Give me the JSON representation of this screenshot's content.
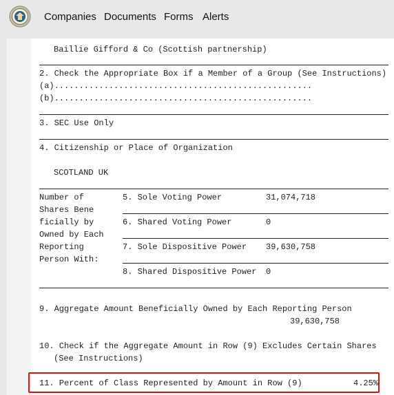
{
  "nav": {
    "links": [
      "Companies",
      "Documents",
      "Forms",
      "Alerts"
    ]
  },
  "document": {
    "reporting_person_name": "Baillie Gifford & Co (Scottish partnership)",
    "row2_label": "2. Check the Appropriate Box if a Member of a Group (See Instructions)",
    "row2_a": "(a)....................................................",
    "row2_b": "(b)....................................................",
    "row3_label": "3. SEC Use Only",
    "row4_label": "4. Citizenship or Place of Organization",
    "row4_value": "SCOTLAND UK",
    "shares_block": {
      "label_lines": [
        "Number of",
        "Shares Bene",
        "ficially by",
        "Owned by Each",
        "Reporting",
        "Person With:"
      ],
      "rows": [
        {
          "label": "5. Sole Voting Power",
          "value": "31,074,718"
        },
        {
          "label": "6. Shared Voting Power",
          "value": "0"
        },
        {
          "label": "7. Sole Dispositive Power",
          "value": "39,630,758"
        },
        {
          "label": "8. Shared Dispositive Power",
          "value": "0"
        }
      ]
    },
    "row9_label": "9. Aggregate Amount Beneficially Owned by Each Reporting Person",
    "row9_value": "39,630,758",
    "row10_label": "10. Check if the Aggregate Amount in Row (9) Excludes Certain Shares",
    "row10_label_cont": "(See Instructions)",
    "row11_label": "11. Percent of Class Represented by Amount in Row (9)",
    "row11_value": "4.25%"
  },
  "colors": {
    "topbar": "#e8e8e8",
    "highlight_border": "#e01010"
  },
  "icons": {
    "logo": "agency-seal-icon"
  }
}
